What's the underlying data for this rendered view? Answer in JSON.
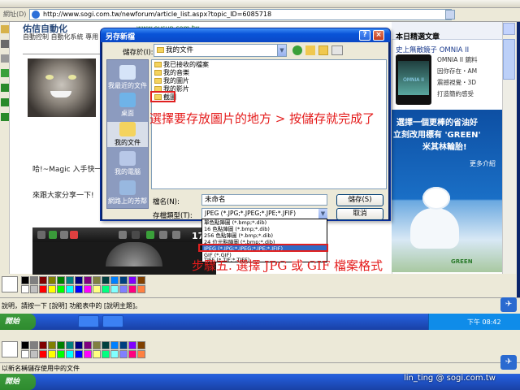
{
  "browser": {
    "address_label": "網址(D)",
    "url": "http://www.sogi.com.tw/newforum/article_list.aspx?topic_ID=6085718"
  },
  "site": {
    "title": "佑佶自動化",
    "url": "www.eusun.com.tw",
    "subtitle": "自動控制 自動化系統 專用",
    "para1": "哈!~Magic 入手快一",
    "para2": "來跟大家分享一下!"
  },
  "phone_banner": {
    "time": "17:02"
  },
  "right_column": {
    "heading": "本日精選文章",
    "link": "史上無敵鏡子 OMNIA II",
    "phone_label": "OMNIA II",
    "lines": [
      "OMNIA II 鏡料",
      "因你存在・AM",
      "震撼視覺・3D",
      "打造簡約感受"
    ]
  },
  "ad": {
    "line1": "選擇一個更棒的省油好",
    "line2": "立刻改用標有 'GREEN'",
    "line3": "米其林輪胎!",
    "more": "更多介紹",
    "green": "GREEN"
  },
  "dialog": {
    "title": "另存新檔",
    "save_in_label": "儲存於(I):",
    "save_in_value": "我的文件",
    "places": [
      "我最近的文件",
      "桌面",
      "我的文件",
      "我的電腦",
      "網路上的芳鄰"
    ],
    "files": [
      "我已接收的檔案",
      "我的音樂",
      "我的圖片",
      "我的影片",
      "截圖"
    ],
    "filename_label": "檔名(N):",
    "filename_value": "未命名",
    "filetype_label": "存檔類型(T):",
    "filetype_value": "JPEG (*.JPG;*.JPEG;*.JPE;*.JFIF)",
    "save_button": "儲存(S)",
    "cancel_button": "取消",
    "filetype_options": [
      "單色點陣圖 (*.bmp;*.dib)",
      "16 色點陣圖 (*.bmp;*.dib)",
      "256 色點陣圖 (*.bmp;*.dib)",
      "24 位元點陣圖 (*.bmp;*.dib)",
      "JPEG (*.JPG;*.JPEG;*.JPE;*.JFIF)",
      "GIF (*.GIF)",
      "TIFF (*.TIF;*.TIFF)"
    ],
    "filetype_selected_index": 4
  },
  "annotations": {
    "step_hint": "選擇要存放圖片的地方 > 按儲存就完成了",
    "step5": "步驟五. 選擇 JPG 或 GIF 檔案格式"
  },
  "status": {
    "help_text": "說明，請按一下 [說明] 功能表中的 [說明主題]。",
    "help_text2": "以新名稱儲存使用中的文件"
  },
  "taskbar": {
    "start_label": "開始",
    "clock": "下午 08:42"
  },
  "watermark": {
    "text": "lin_ting    @ sogi.com.tw"
  },
  "colors": {
    "annotation": "#e41a1a",
    "xp_blue": "#245edb",
    "selection": "#316ac5"
  },
  "palette_colors": [
    "#000000",
    "#808080",
    "#800000",
    "#808000",
    "#008000",
    "#008080",
    "#000080",
    "#800080",
    "#808040",
    "#004040",
    "#0080ff",
    "#004080",
    "#8000ff",
    "#804000",
    "#ffffff",
    "#c0c0c0",
    "#ff0000",
    "#ffff00",
    "#00ff00",
    "#00ffff",
    "#0000ff",
    "#ff00ff",
    "#ffff80",
    "#00ff80",
    "#80ffff",
    "#8080ff",
    "#ff0080",
    "#ff8040"
  ]
}
